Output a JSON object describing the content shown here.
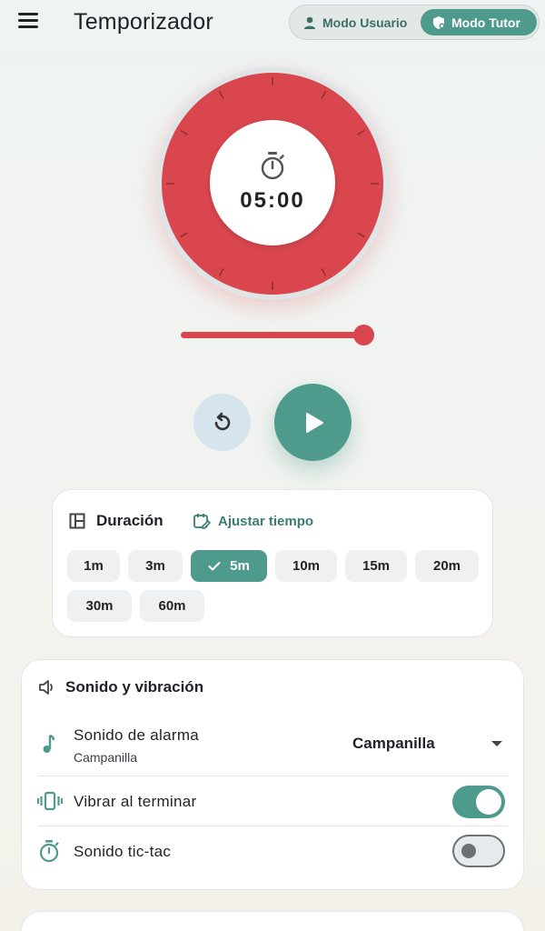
{
  "appbar": {
    "title": "Temporizador",
    "mode_user_label": "Modo Usuario",
    "mode_tutor_label": "Modo Tutor",
    "active_mode": "Modo Tutor"
  },
  "timer": {
    "display": "05:00",
    "dial_color": "#d9464e",
    "slider_fraction": 1.0
  },
  "controls": {
    "reset_icon": "reset-icon",
    "play_icon": "play-icon",
    "accent": "#4e9a8c"
  },
  "duration": {
    "title": "Duración",
    "adjust_label": "Ajustar tiempo",
    "selected": "5m",
    "chips": [
      "1m",
      "3m",
      "5m",
      "10m",
      "15m",
      "20m",
      "30m",
      "60m"
    ]
  },
  "sound": {
    "title": "Sonido y vibración",
    "alarm_label": "Sonido de alarma",
    "alarm_sub": "Campanilla",
    "alarm_value": "Campanilla",
    "vibrate_label": "Vibrar al terminar",
    "vibrate_on": true,
    "tictac_label": "Sonido tic-tac",
    "tictac_on": false
  }
}
